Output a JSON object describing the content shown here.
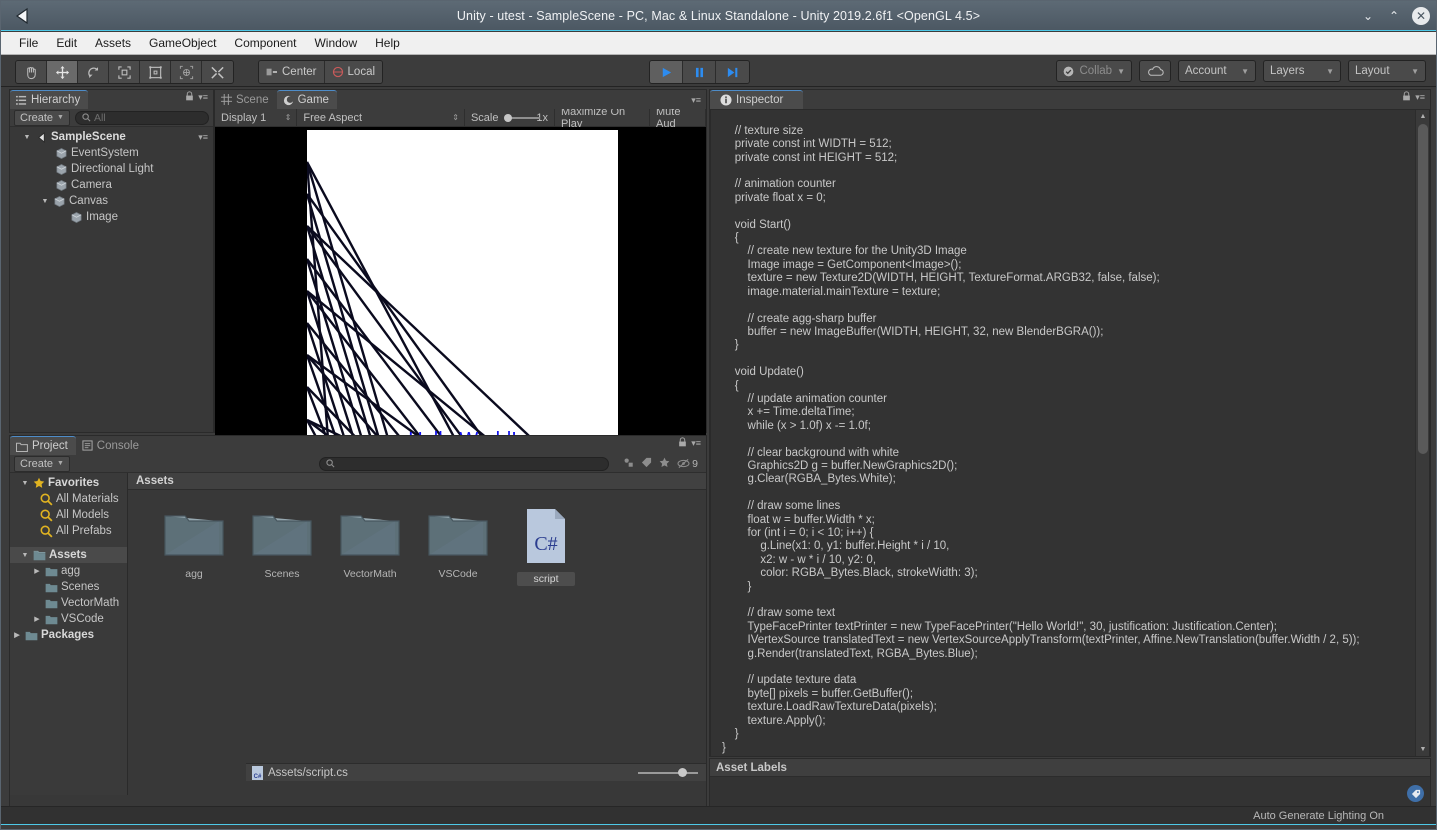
{
  "window": {
    "title": "Unity - utest - SampleScene - PC, Mac & Linux Standalone - Unity 2019.2.6f1 <OpenGL 4.5>",
    "logo_icon": "unity-logo-icon",
    "minimize_icon": "chevron-down-icon",
    "maximize_icon": "chevron-up-icon",
    "close_icon": "close-icon"
  },
  "menubar": {
    "items": [
      {
        "label": "File"
      },
      {
        "label": "Edit"
      },
      {
        "label": "Assets"
      },
      {
        "label": "GameObject"
      },
      {
        "label": "Component"
      },
      {
        "label": "Window"
      },
      {
        "label": "Help"
      }
    ]
  },
  "toolbar": {
    "transform_tools": [
      {
        "name": "hand-tool",
        "icon": "hand-icon",
        "active": false
      },
      {
        "name": "move-tool",
        "icon": "move-arrows-icon",
        "active": true
      },
      {
        "name": "rotate-tool",
        "icon": "rotate-icon",
        "active": false
      },
      {
        "name": "scale-tool",
        "icon": "scale-icon",
        "active": false
      },
      {
        "name": "rect-tool",
        "icon": "rect-transform-icon",
        "active": false
      },
      {
        "name": "transform-tool",
        "icon": "combined-transform-icon",
        "active": false
      },
      {
        "name": "custom-tool",
        "icon": "tools-icon",
        "active": false
      }
    ],
    "pivot_label": "Center",
    "pivot_icon": "pivot-center-icon",
    "rotation_label": "Local",
    "rotation_icon": "local-handle-icon",
    "play_label": "play-icon",
    "pause_label": "pause-icon",
    "step_label": "step-icon",
    "collab_label": "Collab",
    "collab_icon": "collab-check-icon",
    "cloud_icon": "cloud-icon",
    "account_label": "Account",
    "layers_label": "Layers",
    "layout_label": "Layout"
  },
  "hierarchy": {
    "tab_label": "Hierarchy",
    "tab_icon": "hierarchy-icon",
    "lock_icon": "lock-icon",
    "menu_icon": "panel-menu-icon",
    "create_label": "Create",
    "search_placeholder": "All",
    "search_value": "",
    "search_icon": "search-icon",
    "tree": [
      {
        "label": "SampleScene",
        "depth": 0,
        "expanded": true,
        "icon": "unity-scene-icon",
        "bold": true
      },
      {
        "label": "EventSystem",
        "depth": 2,
        "expanded": null,
        "icon": "gameobject-cube-icon",
        "bold": false
      },
      {
        "label": "Directional Light",
        "depth": 2,
        "expanded": null,
        "icon": "gameobject-cube-icon",
        "bold": false
      },
      {
        "label": "Camera",
        "depth": 2,
        "expanded": null,
        "icon": "gameobject-cube-icon",
        "bold": false
      },
      {
        "label": "Canvas",
        "depth": 1,
        "expanded": true,
        "icon": "gameobject-cube-icon",
        "bold": false
      },
      {
        "label": "Image",
        "depth": 2,
        "expanded": null,
        "icon": "gameobject-cube-icon",
        "bold": false
      }
    ]
  },
  "gamepanel": {
    "tabs": [
      {
        "label": "Scene",
        "icon": "scene-grid-icon",
        "active": false
      },
      {
        "label": "Game",
        "icon": "game-icon",
        "active": true
      }
    ],
    "menu_icon": "panel-menu-icon",
    "display_label": "Display 1",
    "aspect_label": "Free Aspect",
    "scale_label": "Scale",
    "scale_value": "1x",
    "maximize_label": "Maximize On Play",
    "mute_label": "Mute Aud",
    "render_text": "Hello World!",
    "render_text_color": "#1111ee",
    "background_color": "#000000",
    "canvas_color": "#ffffff",
    "line_color": "#000000"
  },
  "inspector": {
    "tab_label": "Inspector",
    "tab_icon": "info-icon",
    "lock_icon": "lock-icon",
    "menu_icon": "panel-menu-icon",
    "scroll_up_icon": "scroll-up-arrow-icon",
    "scroll_down_icon": "scroll-down-arrow-icon",
    "code": "    private ImageBuffer buffer;\n\n    // texture size\n    private const int WIDTH = 512;\n    private const int HEIGHT = 512;\n\n    // animation counter\n    private float x = 0;\n\n    void Start()\n    {\n        // create new texture for the Unity3D Image\n        Image image = GetComponent<Image>();\n        texture = new Texture2D(WIDTH, HEIGHT, TextureFormat.ARGB32, false, false);\n        image.material.mainTexture = texture;\n\n        // create agg-sharp buffer\n        buffer = new ImageBuffer(WIDTH, HEIGHT, 32, new BlenderBGRA());\n    }\n\n    void Update()\n    {\n        // update animation counter\n        x += Time.deltaTime;\n        while (x > 1.0f) x -= 1.0f;\n\n        // clear background with white\n        Graphics2D g = buffer.NewGraphics2D();\n        g.Clear(RGBA_Bytes.White);\n\n        // draw some lines\n        float w = buffer.Width * x;\n        for (int i = 0; i < 10; i++) {\n            g.Line(x1: 0, y1: buffer.Height * i / 10,\n            x2: w - w * i / 10, y2: 0,\n            color: RGBA_Bytes.Black, strokeWidth: 3);\n        }\n\n        // draw some text\n        TypeFacePrinter textPrinter = new TypeFacePrinter(\"Hello World!\", 30, justification: Justification.Center);\n        IVertexSource translatedText = new VertexSourceApplyTransform(textPrinter, Affine.NewTranslation(buffer.Width / 2, 5));\n        g.Render(translatedText, RGBA_Bytes.Blue);\n\n        // update texture data\n        byte[] pixels = buffer.GetBuffer();\n        texture.LoadRawTextureData(pixels);\n        texture.Apply();\n    }\n}"
  },
  "asset_labels": {
    "header": "Asset Labels",
    "tag_icon": "tag-icon"
  },
  "project": {
    "tabs": [
      {
        "label": "Project",
        "icon": "folder-icon",
        "active": true
      },
      {
        "label": "Console",
        "icon": "console-icon",
        "active": false
      }
    ],
    "lock_icon": "lock-icon",
    "menu_icon": "panel-menu-icon",
    "create_label": "Create",
    "search_placeholder": "",
    "search_value": "",
    "search_icon": "search-icon",
    "filter_icons": [
      {
        "name": "type-filter-icon"
      },
      {
        "name": "label-filter-icon"
      },
      {
        "name": "favorite-filter-icon"
      }
    ],
    "hidden_count_icon": "eye-off-icon",
    "hidden_count": "9",
    "tree": [
      {
        "label": "Favorites",
        "depth": 0,
        "expanded": true,
        "icon": "star-icon",
        "bold": true,
        "selected": false
      },
      {
        "label": "All Materials",
        "depth": 1,
        "expanded": null,
        "icon": "search-icon",
        "bold": false,
        "selected": false
      },
      {
        "label": "All Models",
        "depth": 1,
        "expanded": null,
        "icon": "search-icon",
        "bold": false,
        "selected": false
      },
      {
        "label": "All Prefabs",
        "depth": 1,
        "expanded": null,
        "icon": "search-icon",
        "bold": false,
        "selected": false
      },
      {
        "label": "Assets",
        "depth": 0,
        "expanded": true,
        "icon": "folder-icon",
        "bold": true,
        "selected": true
      },
      {
        "label": "agg",
        "depth": 1,
        "expanded": false,
        "icon": "folder-icon",
        "bold": false,
        "selected": false
      },
      {
        "label": "Scenes",
        "depth": 1,
        "expanded": null,
        "icon": "folder-icon",
        "bold": false,
        "selected": false
      },
      {
        "label": "VectorMath",
        "depth": 1,
        "expanded": null,
        "icon": "folder-icon",
        "bold": false,
        "selected": false
      },
      {
        "label": "VSCode",
        "depth": 1,
        "expanded": false,
        "icon": "folder-icon",
        "bold": false,
        "selected": false
      },
      {
        "label": "Packages",
        "depth": 0,
        "expanded": false,
        "icon": "folder-icon",
        "bold": true,
        "selected": false
      }
    ],
    "breadcrumb": "Assets",
    "grid_items": [
      {
        "label": "agg",
        "type": "folder",
        "selected": false
      },
      {
        "label": "Scenes",
        "type": "folder",
        "selected": false
      },
      {
        "label": "VectorMath",
        "type": "folder",
        "selected": false
      },
      {
        "label": "VSCode",
        "type": "folder",
        "selected": false
      },
      {
        "label": "script",
        "type": "csharp-script",
        "selected": true,
        "badge": "C#"
      }
    ],
    "footer_path": "Assets/script.cs",
    "footer_icon": "csharp-file-icon",
    "zoom_value": "medium"
  },
  "statusbar": {
    "text": "Auto Generate Lighting On"
  },
  "colors": {
    "accent_blue": "#4ec9e8",
    "play_blue": "#2d8cf0",
    "panel_bg": "#383838",
    "toolbar_bg": "#3c3c3c",
    "title_bg": "#4c5863"
  }
}
